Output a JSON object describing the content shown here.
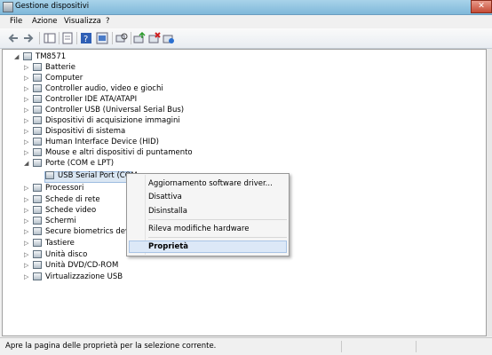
{
  "window": {
    "title": "Gestione dispositivi",
    "close_glyph": "✕"
  },
  "menu": [
    "File",
    "Azione",
    "Visualizza",
    "?"
  ],
  "toolbar": [
    "back-arrow-icon",
    "forward-arrow-icon",
    "console-tree-icon",
    "properties-icon",
    "help-icon",
    "scan-hardware-icon",
    "update-driver-icon",
    "uninstall-icon",
    "disable-icon"
  ],
  "tree": {
    "root": "TM8571",
    "nodes": [
      {
        "label": "Batterie",
        "expanded": false
      },
      {
        "label": "Computer",
        "expanded": false
      },
      {
        "label": "Controller audio, video e giochi",
        "expanded": false
      },
      {
        "label": "Controller IDE ATA/ATAPI",
        "expanded": false
      },
      {
        "label": "Controller USB (Universal Serial Bus)",
        "expanded": false
      },
      {
        "label": "Dispositivi di acquisizione immagini",
        "expanded": false
      },
      {
        "label": "Dispositivi di sistema",
        "expanded": false
      },
      {
        "label": "Human Interface Device (HID)",
        "expanded": false
      },
      {
        "label": "Mouse e altri dispositivi di puntamento",
        "expanded": false
      },
      {
        "label": "Porte (COM e LPT)",
        "expanded": true
      },
      {
        "label": "USB Serial Port (COM",
        "expanded": false,
        "child": true,
        "selected": true
      },
      {
        "label": "Processori",
        "expanded": false
      },
      {
        "label": "Schede di rete",
        "expanded": false
      },
      {
        "label": "Schede video",
        "expanded": false
      },
      {
        "label": "Schermi",
        "expanded": false
      },
      {
        "label": "Secure biometrics device",
        "expanded": false
      },
      {
        "label": "Tastiere",
        "expanded": false
      },
      {
        "label": "Unità disco",
        "expanded": false
      },
      {
        "label": "Unità DVD/CD-ROM",
        "expanded": false
      },
      {
        "label": "Virtualizzazione USB",
        "expanded": false
      }
    ]
  },
  "context_menu": {
    "items": [
      {
        "label": "Aggiornamento software driver..."
      },
      {
        "label": "Disattiva"
      },
      {
        "label": "Disinstalla"
      },
      {
        "label": "Rileva modifiche hardware"
      },
      {
        "label": "Proprietà",
        "bold": true,
        "highlighted": true
      }
    ]
  },
  "status": {
    "text": "Apre la pagina delle proprietà per la selezione corrente."
  }
}
